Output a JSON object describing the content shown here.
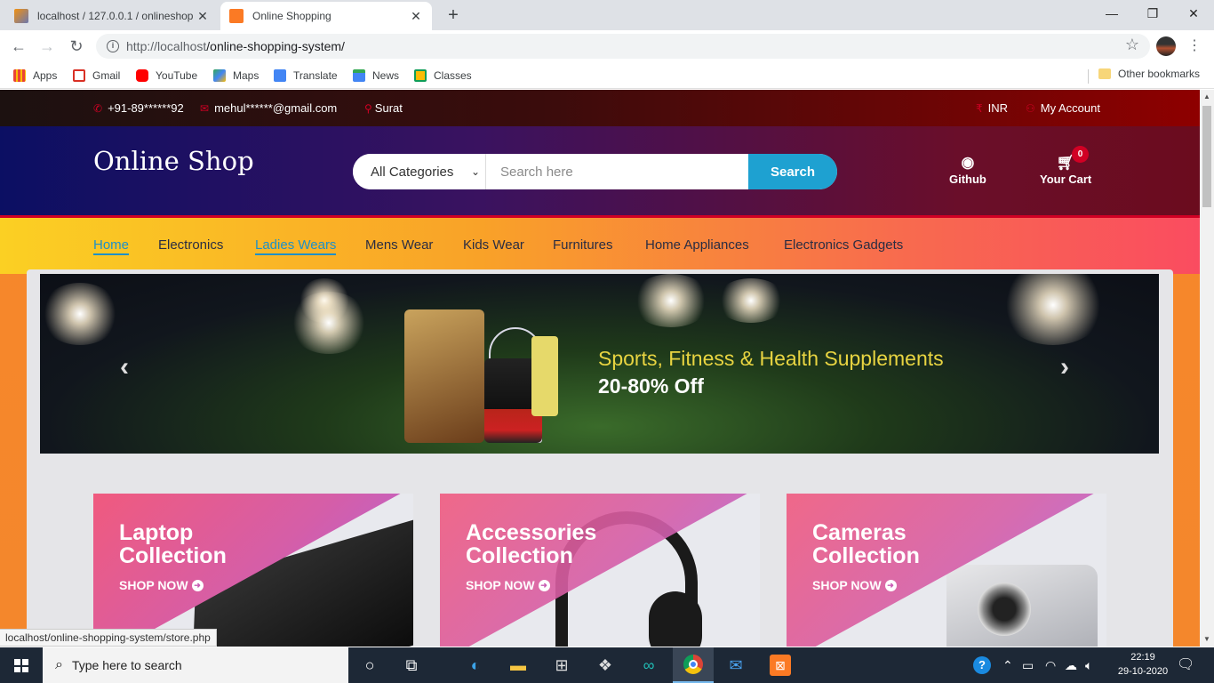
{
  "browser": {
    "tabs": [
      {
        "title": "localhost / 127.0.0.1 / onlineshop",
        "active": false
      },
      {
        "title": "Online Shopping",
        "active": true
      }
    ],
    "url_prefix": "http://localhost",
    "url_path": "/online-shopping-system/",
    "bookmarks": [
      "Apps",
      "Gmail",
      "YouTube",
      "Maps",
      "Translate",
      "News",
      "Classes"
    ],
    "other_bookmarks": "Other bookmarks",
    "status_url": "localhost/online-shopping-system/store.php"
  },
  "site": {
    "top_header": {
      "phone": "+91-89******92",
      "email": "mehul******@gmail.com",
      "location": "Surat",
      "currency": "INR",
      "account": "My Account"
    },
    "logo": "Online Shop",
    "search": {
      "category": "All Categories",
      "placeholder": "Search here",
      "button": "Search"
    },
    "github_label": "Github",
    "cart": {
      "label": "Your Cart",
      "count": "0"
    },
    "nav": [
      "Home",
      "Electronics",
      "Ladies Wears",
      "Mens Wear",
      "Kids Wear",
      "Furnitures",
      "Home Appliances",
      "Electronics Gadgets"
    ],
    "banner": {
      "headline": "Sports, Fitness & Health Supplements",
      "sub": "20-80% Off"
    },
    "collections": [
      {
        "line1": "Laptop",
        "line2": "Collection",
        "link": "SHOP NOW"
      },
      {
        "line1": "Accessories",
        "line2": "Collection",
        "link": "SHOP NOW"
      },
      {
        "line1": "Cameras",
        "line2": "Collection",
        "link": "SHOP NOW"
      }
    ]
  },
  "taskbar": {
    "search_placeholder": "Type here to search",
    "time": "22:19",
    "date": "29-10-2020"
  }
}
